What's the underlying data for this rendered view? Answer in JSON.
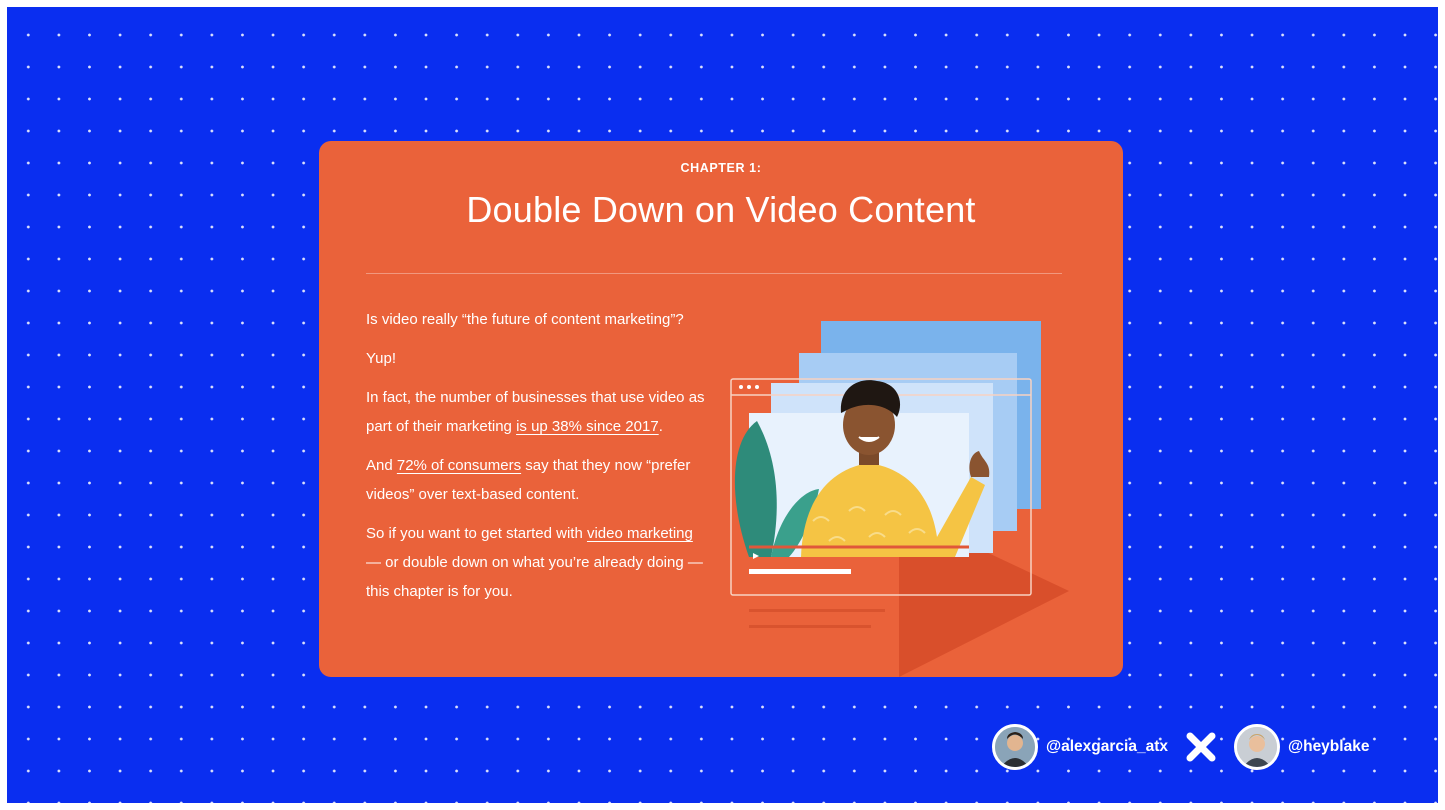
{
  "card": {
    "chapter_label": "CHAPTER 1:",
    "title": "Double Down on Video Content",
    "paragraphs": {
      "p1": "Is video really “the future of content marketing”?",
      "p2": "Yup!",
      "p3_before": "In fact, the number of businesses that use video as part of their marketing ",
      "p3_link": "is up 38% since 2017",
      "p3_after": ".",
      "p4_before": "And ",
      "p4_link": "72% of consumers",
      "p4_after": " say that they now “prefer videos” over text-based content.",
      "p5_before": "So if you want to get started with ",
      "p5_link": "video marketing",
      "p5_after": " — or double down on what you’re already doing — this chapter is for you."
    }
  },
  "footer": {
    "handle_left": "@alexgarcia_atx",
    "separator_icon": "close-x-icon",
    "handle_right": "@heyblake"
  },
  "colors": {
    "background": "#0a2ef0",
    "card": "#ea623a",
    "text": "#ffffff"
  }
}
